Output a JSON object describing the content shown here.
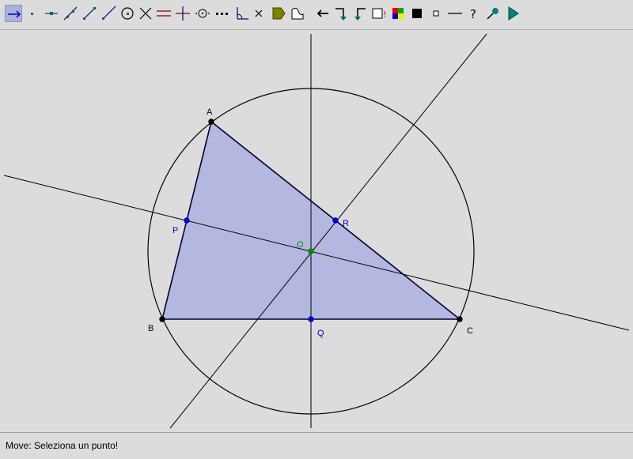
{
  "toolbar": {
    "tools": [
      {
        "id": "move",
        "icon": "move-arrow-icon",
        "active": true
      },
      {
        "id": "point",
        "icon": "point-icon"
      },
      {
        "id": "point-on-line",
        "icon": "point-on-line-icon"
      },
      {
        "id": "line",
        "icon": "line-icon"
      },
      {
        "id": "segment",
        "icon": "segment-icon"
      },
      {
        "id": "ray",
        "icon": "ray-icon"
      },
      {
        "id": "circle",
        "icon": "circle-icon"
      },
      {
        "id": "intersection",
        "icon": "intersection-icon"
      },
      {
        "id": "parallel",
        "icon": "parallel-icon"
      },
      {
        "id": "perpendicular",
        "icon": "perpendicular-icon"
      },
      {
        "id": "midpoint",
        "icon": "midpoint-icon"
      },
      {
        "id": "locus",
        "icon": "locus-icon"
      },
      {
        "id": "angle",
        "icon": "angle-icon"
      },
      {
        "id": "delete",
        "icon": "delete-icon"
      },
      {
        "id": "polygon",
        "icon": "polygon-icon"
      },
      {
        "id": "measure",
        "icon": "measure-icon"
      },
      {
        "id": "undo",
        "icon": "undo-arrow-icon"
      },
      {
        "id": "step-forward",
        "icon": "step-forward-icon"
      },
      {
        "id": "step-back",
        "icon": "step-back-icon"
      },
      {
        "id": "macro",
        "icon": "macro-icon"
      },
      {
        "id": "color",
        "icon": "color-palette-icon"
      },
      {
        "id": "fill",
        "icon": "fill-square-icon"
      },
      {
        "id": "point-size",
        "icon": "point-size-icon"
      },
      {
        "id": "line-style",
        "icon": "line-style-icon"
      },
      {
        "id": "help",
        "icon": "help-icon"
      },
      {
        "id": "pin",
        "icon": "pin-icon"
      },
      {
        "id": "play",
        "icon": "play-icon"
      }
    ]
  },
  "geometry": {
    "colors": {
      "polygon_fill": "#b4b8e0",
      "point_black": "#000000",
      "point_blue": "#0000cc",
      "point_green": "#008800"
    },
    "points": [
      {
        "name": "A",
        "label": "A",
        "color": "#000000"
      },
      {
        "name": "B",
        "label": "B",
        "color": "#000000"
      },
      {
        "name": "C",
        "label": "C",
        "color": "#000000"
      },
      {
        "name": "P",
        "label": "P",
        "color": "#0000cc"
      },
      {
        "name": "Q",
        "label": "Q",
        "color": "#0000cc"
      },
      {
        "name": "R",
        "label": "R",
        "color": "#0000cc"
      },
      {
        "name": "O",
        "label": "O",
        "color": "#008800"
      }
    ]
  },
  "status": {
    "text": "Move: Seleziona un punto!"
  }
}
